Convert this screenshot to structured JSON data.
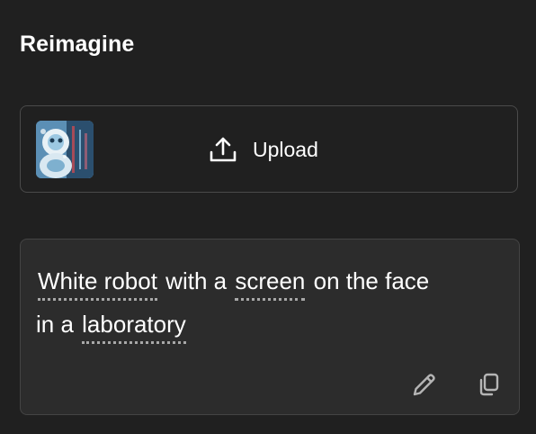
{
  "panel": {
    "title": "Reimagine"
  },
  "upload": {
    "label": "Upload",
    "thumbnail_icon": "robot-thumbnail",
    "upload_icon": "upload-icon"
  },
  "prompt": {
    "text_1": "White robot with a",
    "kw_1": "screen",
    "text_2": "on the face",
    "text_3": "in a",
    "kw_2": "laboratory",
    "kw_0": "White robot",
    "edit_icon": "pencil-icon",
    "copy_icon": "copy-icon"
  },
  "colors": {
    "background": "#202020",
    "card_border": "#4a4a4a",
    "prompt_bg": "#2c2c2c",
    "text": "#ffffff",
    "icon": "#b5b5b5"
  }
}
